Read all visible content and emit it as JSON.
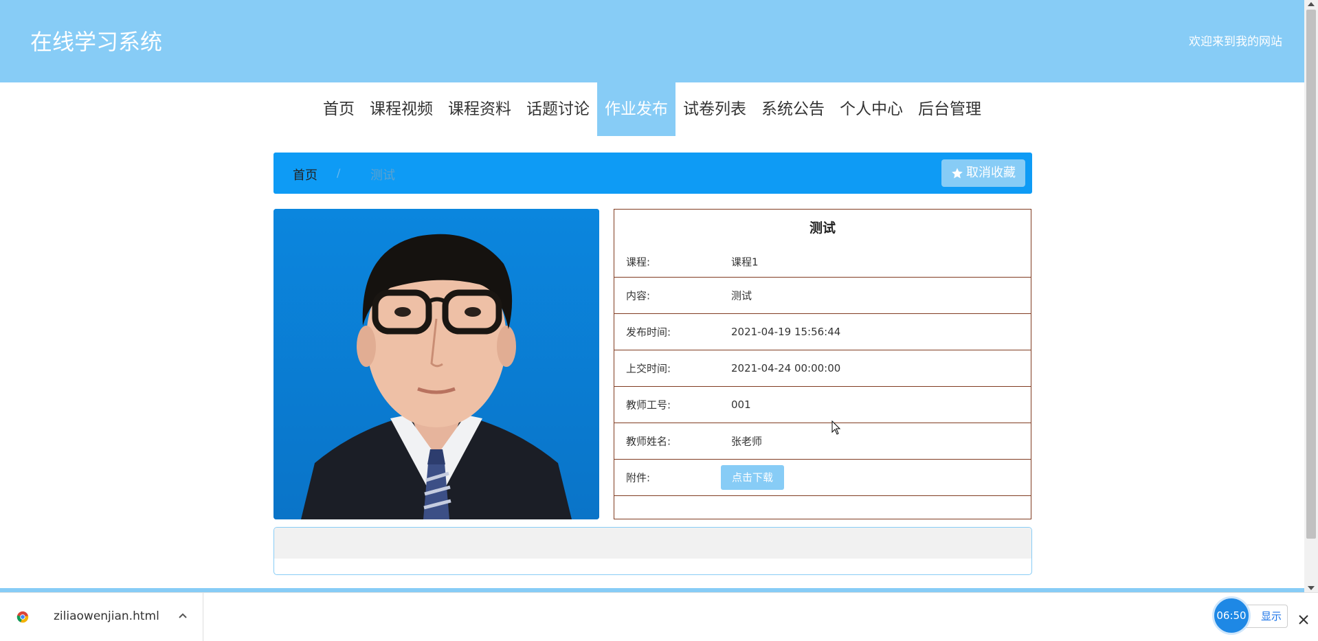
{
  "header": {
    "site_title": "在线学习系统",
    "welcome": "欢迎来到我的网站"
  },
  "nav": {
    "items": [
      "首页",
      "课程视频",
      "课程资料",
      "话题讨论",
      "作业发布",
      "试卷列表",
      "系统公告",
      "个人中心",
      "后台管理"
    ],
    "active": "作业发布"
  },
  "breadcrumb": {
    "home": "首页",
    "separator": "/",
    "current": "测试",
    "favorite_label": "取消收藏"
  },
  "detail": {
    "title": "测试",
    "rows": [
      {
        "label": "课程:",
        "value": "课程1"
      },
      {
        "label": "内容:",
        "value": "测试"
      },
      {
        "label": "发布时间:",
        "value": "2021-04-19 15:56:44"
      },
      {
        "label": "上交时间:",
        "value": "2021-04-24 00:00:00"
      },
      {
        "label": "教师工号:",
        "value": "001"
      },
      {
        "label": "教师姓名:",
        "value": "张老师"
      }
    ],
    "attachment_label": "附件:",
    "download_label": "点击下载"
  },
  "download_bar": {
    "filename": "ziliaowenjian.html",
    "show_all": "显示",
    "timer": "06:50"
  },
  "colors": {
    "primary_light": "#87ccf6",
    "breadcrumb_blue": "#0e9bf5",
    "table_border": "#7f3a1f"
  },
  "icons": [
    "star-icon",
    "chrome-icon",
    "chevron-up-icon",
    "close-icon",
    "mouse-cursor-icon"
  ]
}
